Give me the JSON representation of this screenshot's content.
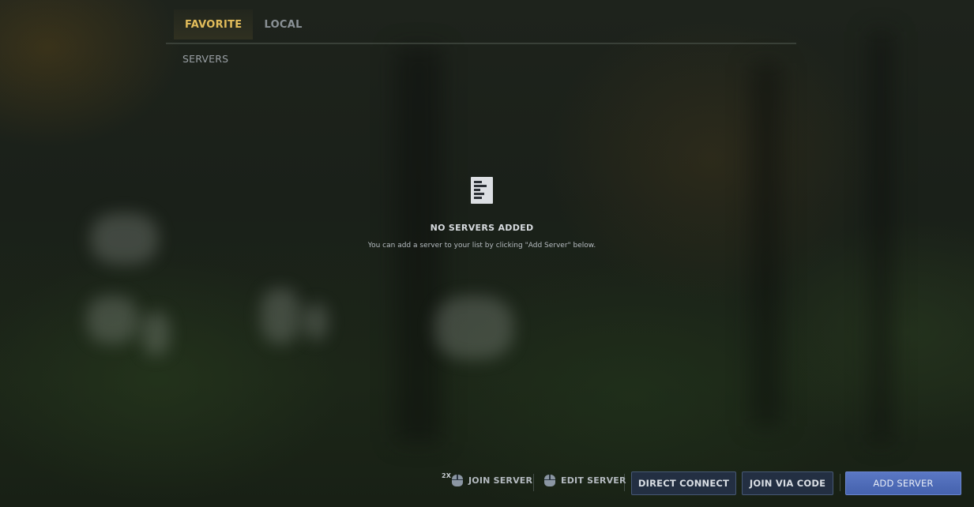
{
  "tabs": [
    {
      "label": "FAVORITE",
      "active": true
    },
    {
      "label": "LOCAL",
      "active": false
    }
  ],
  "section": {
    "label": "SERVERS"
  },
  "empty_state": {
    "icon": "document-list-icon",
    "title": "NO SERVERS ADDED",
    "subtitle": "You can add a server to your list by clicking \"Add Server\" below."
  },
  "bottom_bar": {
    "join_hint": {
      "badge": "2X",
      "icon": "mouse-left-click-icon",
      "label": "JOIN SERVER"
    },
    "edit_hint": {
      "icon": "mouse-right-click-icon",
      "label": "EDIT SERVER"
    },
    "direct_connect_label": "DIRECT CONNECT",
    "join_via_code_label": "JOIN VIA CODE",
    "add_server_label": "ADD SERVER"
  },
  "colors": {
    "active_tab": "#e3bd5b",
    "inactive_tab": "#8a9196",
    "button_dark_bg": "#232f42",
    "button_primary_bg": "#4f6cb8"
  }
}
